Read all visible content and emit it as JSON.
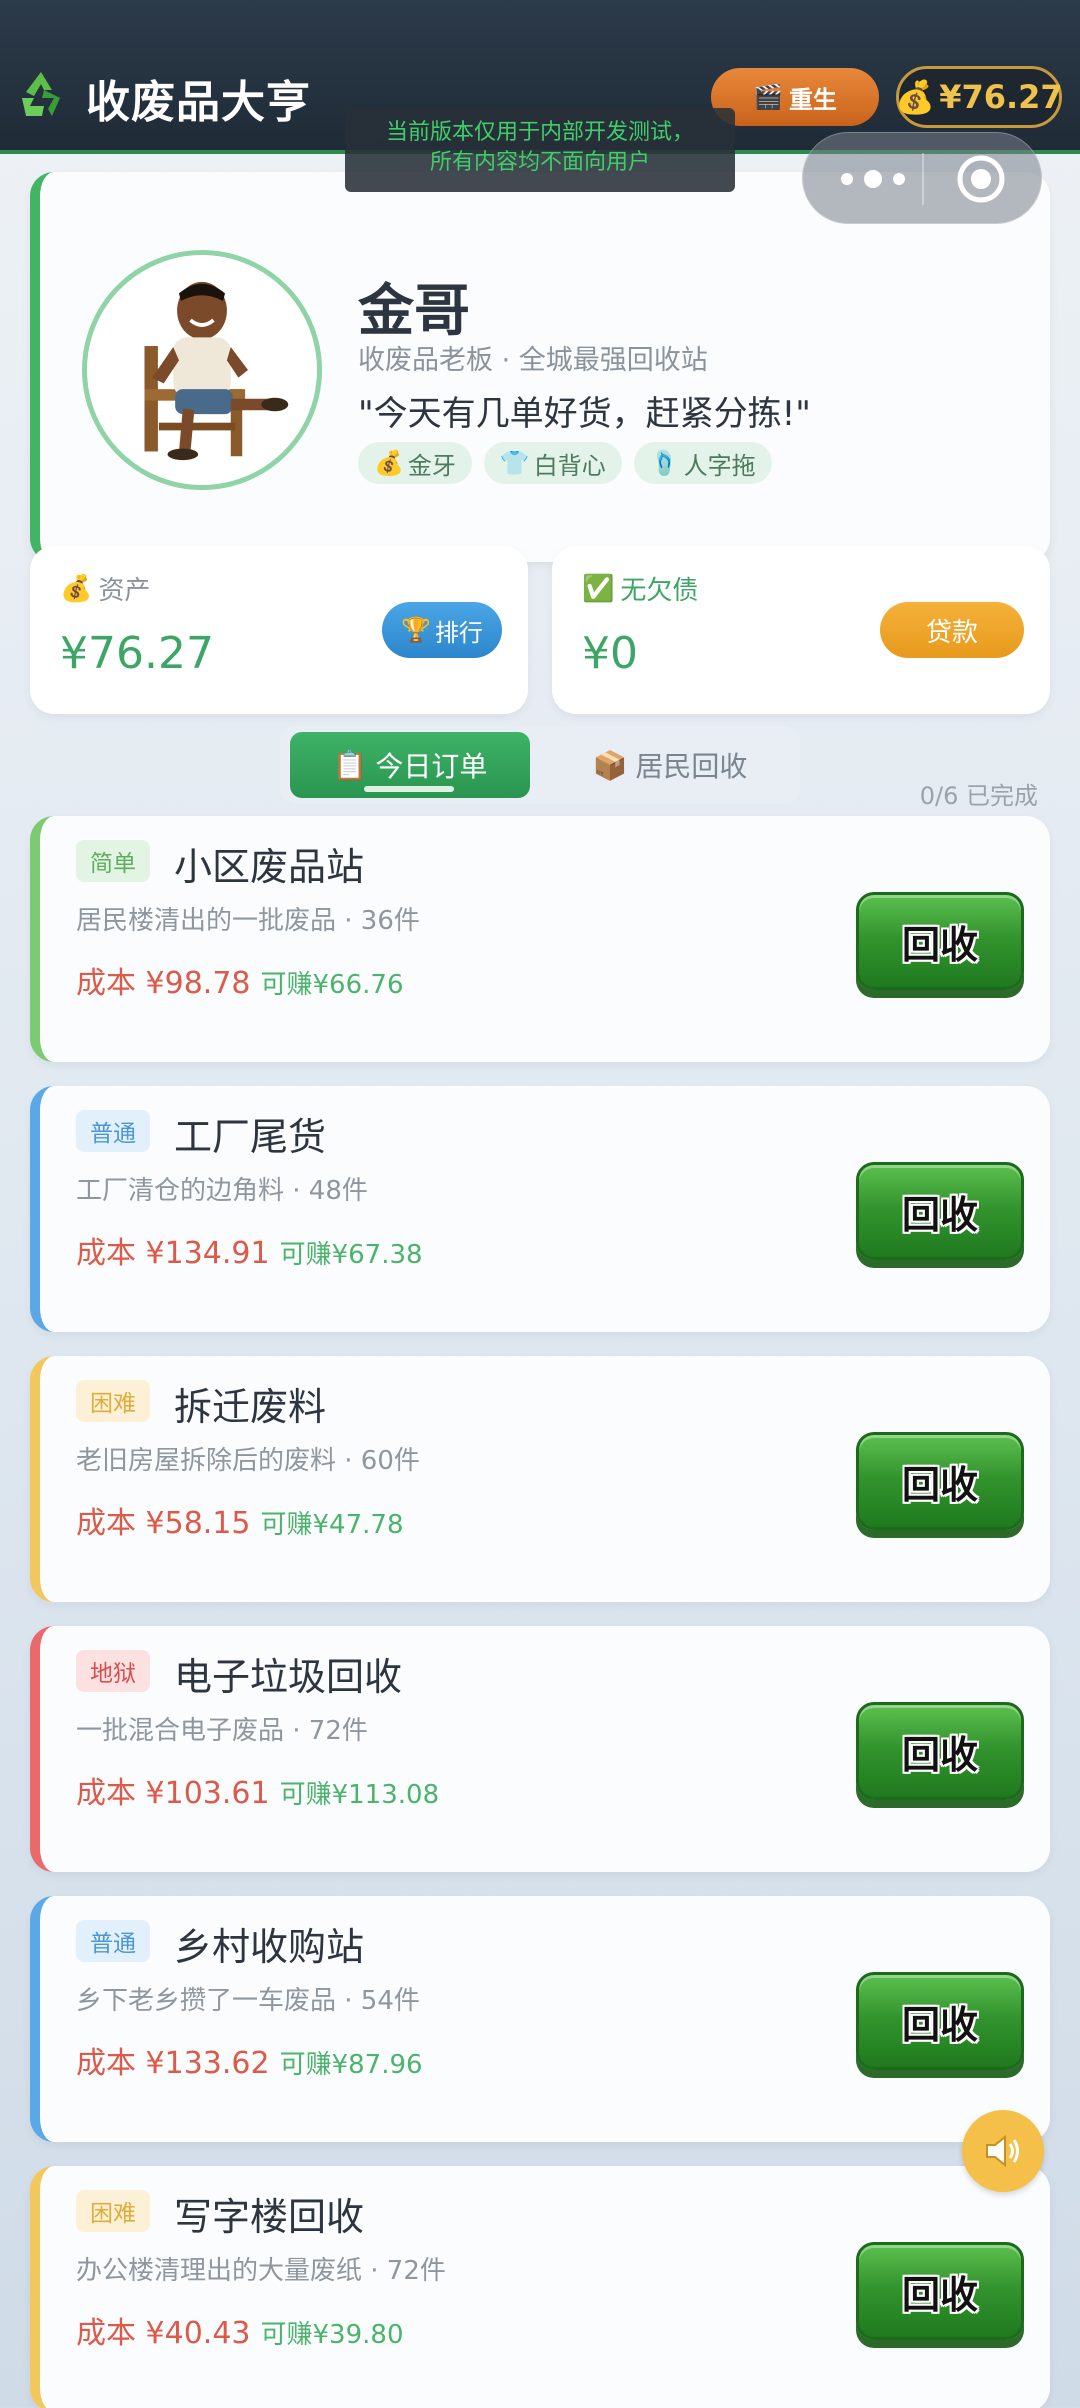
{
  "header": {
    "title": "收废品大亨",
    "rebirth_label": "重生",
    "balance": "¥76.27",
    "dev_notice_line1": "当前版本仅用于内部开发测试，",
    "dev_notice_line2": "所有内容均不面向用户"
  },
  "profile": {
    "name": "金哥",
    "subtitle": "收废品老板 · 全城最强回收站",
    "quote": "\"今天有几单好货，赶紧分拣!\"",
    "tags": [
      "金牙",
      "白背心",
      "人字拖"
    ]
  },
  "stats": {
    "assets_label": "资产",
    "assets_value": "¥76.27",
    "rank_label": "排行",
    "debt_label": "无欠债",
    "debt_value": "¥0",
    "loan_label": "贷款"
  },
  "tabs": {
    "today": "今日订单",
    "resident": "居民回收",
    "progress": "0/6 已完成"
  },
  "orders": [
    {
      "difficulty": "简单",
      "title": "小区废品站",
      "desc": "居民楼清出的一批废品 · 36件",
      "cost": "成本 ¥98.78",
      "earn": "可赚¥66.76",
      "button": "回收"
    },
    {
      "difficulty": "普通",
      "title": "工厂尾货",
      "desc": "工厂清仓的边角料 · 48件",
      "cost": "成本 ¥134.91",
      "earn": "可赚¥67.38",
      "button": "回收"
    },
    {
      "difficulty": "困难",
      "title": "拆迁废料",
      "desc": "老旧房屋拆除后的废料 · 60件",
      "cost": "成本 ¥58.15",
      "earn": "可赚¥47.78",
      "button": "回收"
    },
    {
      "difficulty": "地狱",
      "title": "电子垃圾回收",
      "desc": "一批混合电子废品 · 72件",
      "cost": "成本 ¥103.61",
      "earn": "可赚¥113.08",
      "button": "回收"
    },
    {
      "difficulty": "普通",
      "title": "乡村收购站",
      "desc": "乡下老乡攒了一车废品 · 54件",
      "cost": "成本 ¥133.62",
      "earn": "可赚¥87.96",
      "button": "回收"
    },
    {
      "difficulty": "困难",
      "title": "写字楼回收",
      "desc": "办公楼清理出的大量废纸 · 72件",
      "cost": "成本 ¥40.43",
      "earn": "可赚¥39.80",
      "button": "回收"
    }
  ],
  "colors": {
    "easy": "#7ccb72",
    "normal": "#5aa9e6",
    "hard": "#f2c75c",
    "hell": "#e86a6a",
    "accent_green": "#3eb267"
  },
  "icons": {
    "logo": "recycle-icon",
    "rebirth": "clapperboard-icon",
    "coin": "money-bag-icon",
    "rank": "trophy-icon",
    "debt": "check-icon",
    "today_tab": "clipboard-icon",
    "resident_tab": "package-icon",
    "sound": "speaker-icon"
  }
}
